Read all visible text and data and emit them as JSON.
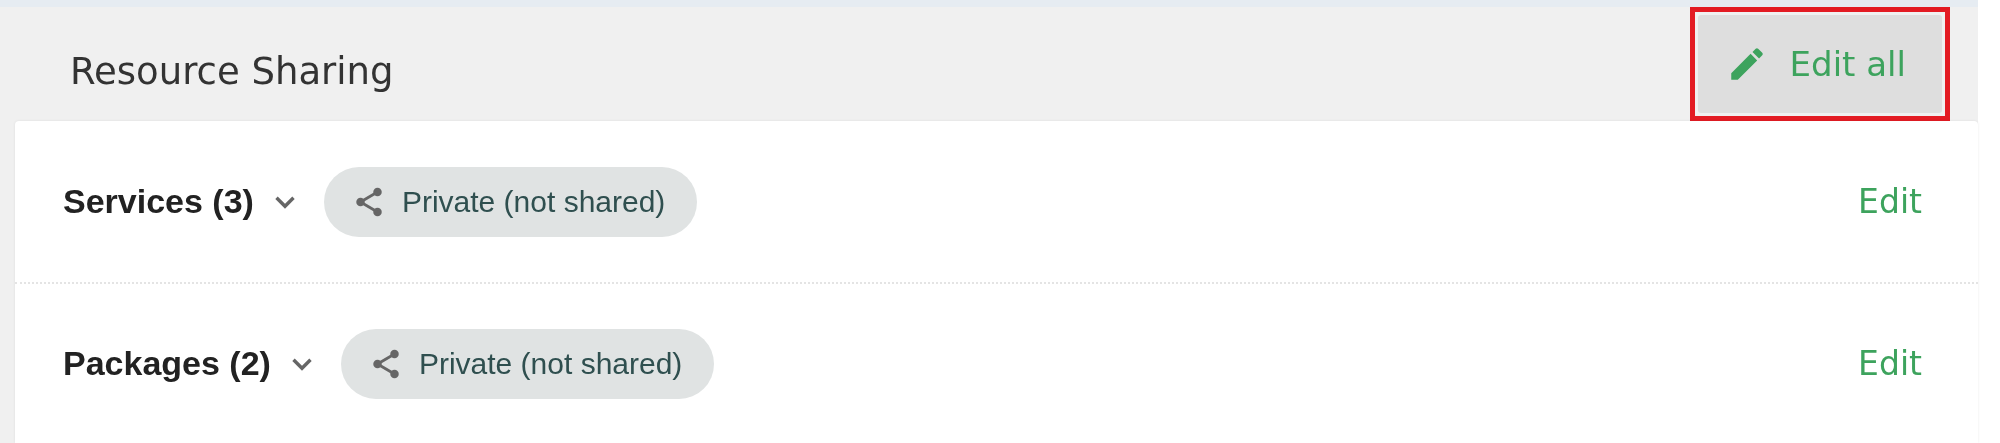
{
  "header": {
    "title": "Resource Sharing",
    "edit_all": {
      "label": "Edit all",
      "highlighted": true
    }
  },
  "sections": [
    {
      "title": "Services (3)",
      "expanded": false,
      "sharing": "Private (not shared)",
      "action": "Edit"
    },
    {
      "title": "Packages (2)",
      "expanded": false,
      "sharing": "Private (not shared)",
      "action": "Edit"
    }
  ]
}
